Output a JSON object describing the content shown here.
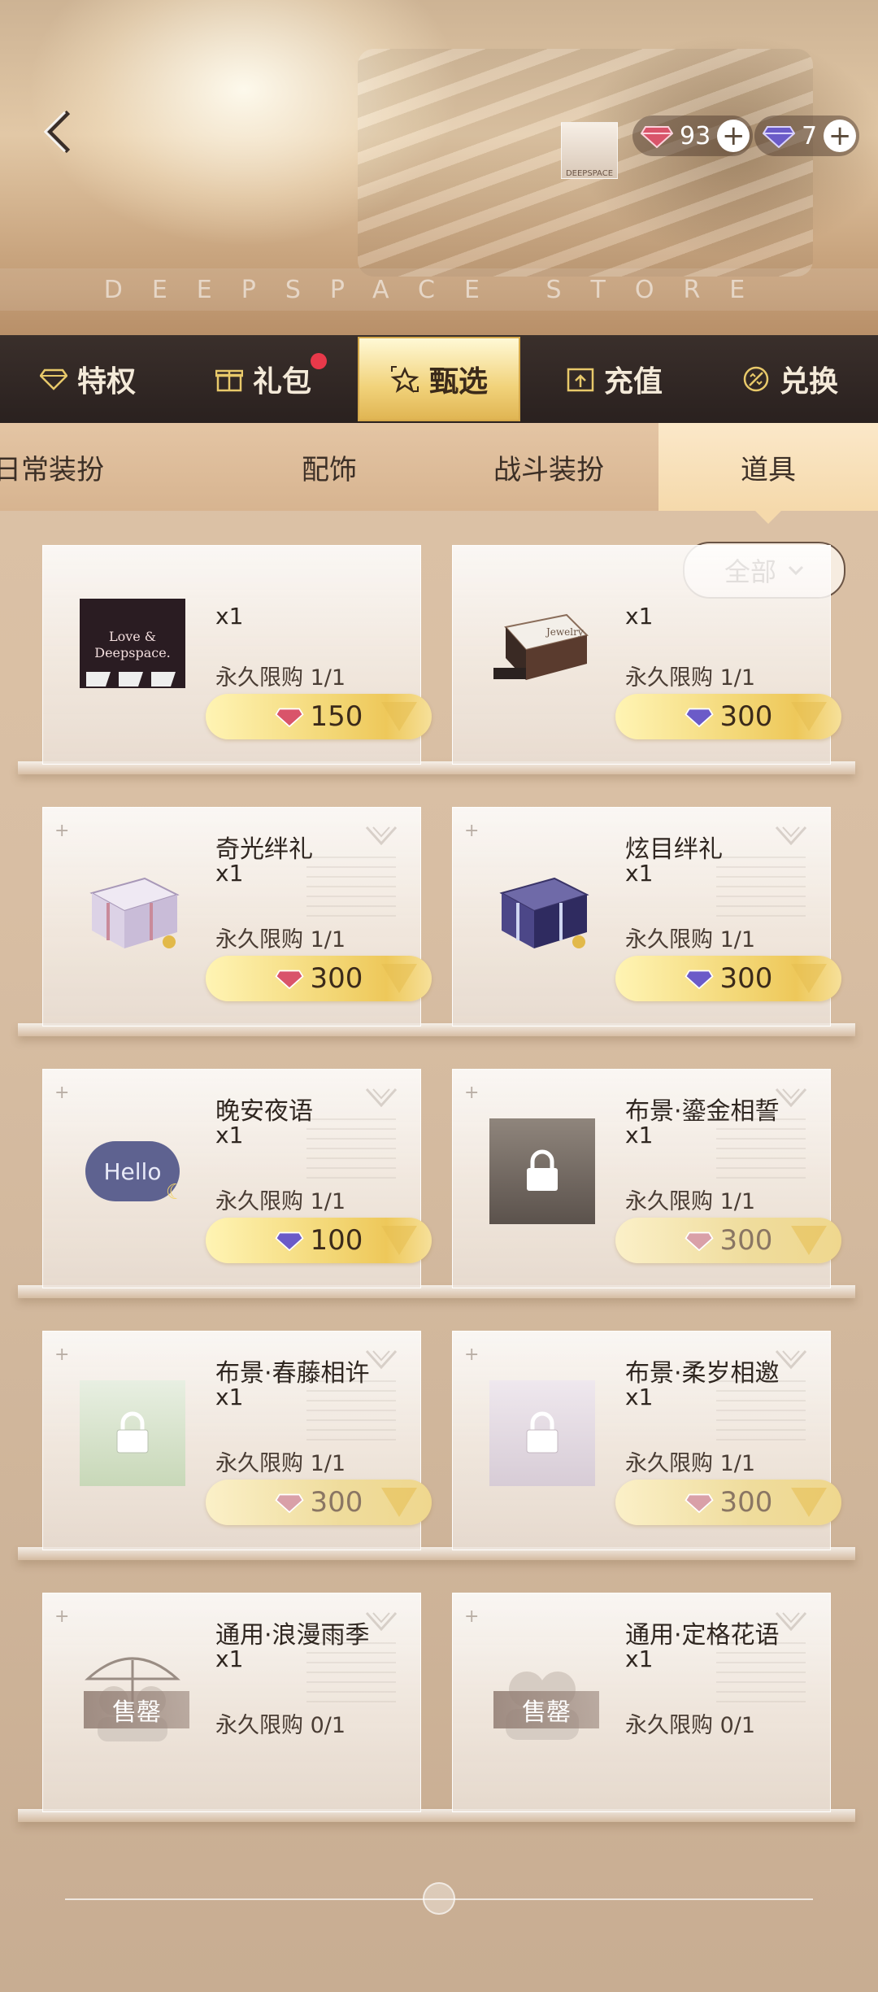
{
  "header": {
    "store_banner_text": "DEEPSPACE STORE",
    "currency": [
      {
        "amount": "93",
        "icon": "red-diamond-icon"
      },
      {
        "amount": "7",
        "icon": "purple-diamond-icon"
      }
    ],
    "logo_text": "DEEPSPACE"
  },
  "main_tabs": [
    {
      "label": "特权",
      "icon": "diamond-outline-icon"
    },
    {
      "label": "礼包",
      "icon": "gift-icon",
      "has_badge": true
    },
    {
      "label": "甄选",
      "icon": "star-frame-icon",
      "active": true
    },
    {
      "label": "充值",
      "icon": "upload-box-icon"
    },
    {
      "label": "兑换",
      "icon": "exchange-circle-icon"
    }
  ],
  "sub_tabs": [
    {
      "label": "日常装扮"
    },
    {
      "label": "配饰"
    },
    {
      "label": "战斗装扮"
    },
    {
      "label": "道具",
      "active": true
    }
  ],
  "filter": {
    "label": "全部"
  },
  "items": [
    {
      "name": "",
      "qty": "x1",
      "limit": "永久限购 1/1",
      "price": "150",
      "currency": "red",
      "img": "love-and-deepspace-card"
    },
    {
      "name": "",
      "qty": "x1",
      "limit": "永久限购 1/1",
      "price": "300",
      "currency": "purple",
      "img": "jewelry-box"
    },
    {
      "name": "奇光绊礼",
      "qty": "x1",
      "limit": "永久限购 1/1",
      "price": "300",
      "currency": "red",
      "img": "white-gift-box"
    },
    {
      "name": "炫目绊礼",
      "qty": "x1",
      "limit": "永久限购 1/1",
      "price": "300",
      "currency": "purple",
      "img": "purple-gift-box"
    },
    {
      "name": "晚安夜语",
      "qty": "x1",
      "limit": "永久限购 1/1",
      "price": "100",
      "currency": "purple",
      "img": "hello-bubble",
      "img_text": "Hello"
    },
    {
      "name": "布景·鎏金相誓",
      "qty": "x1",
      "limit": "永久限购 1/1",
      "price": "300",
      "currency": "red",
      "img": "locked-scene-dark",
      "dim": true
    },
    {
      "name": "布景·春藤相许",
      "qty": "x1",
      "limit": "永久限购 1/1",
      "price": "300",
      "currency": "red",
      "img": "locked-scene-green",
      "dim": true
    },
    {
      "name": "布景·柔岁相邀",
      "qty": "x1",
      "limit": "永久限购 1/1",
      "price": "300",
      "currency": "red",
      "img": "locked-scene-light",
      "dim": true
    },
    {
      "name": "通用·浪漫雨季",
      "qty": "x1",
      "limit": "永久限购 0/1",
      "sold_label": "售罄",
      "img": "umbrella-couple"
    },
    {
      "name": "通用·定格花语",
      "qty": "x1",
      "limit": "永久限购 0/1",
      "sold_label": "售罄",
      "img": "couple-silhouette"
    }
  ],
  "colors": {
    "accent_gold": "#f1d27a",
    "tab_bar": "#2a211f",
    "red_gem": "#d9546a",
    "purple_gem": "#6b5bc8"
  }
}
